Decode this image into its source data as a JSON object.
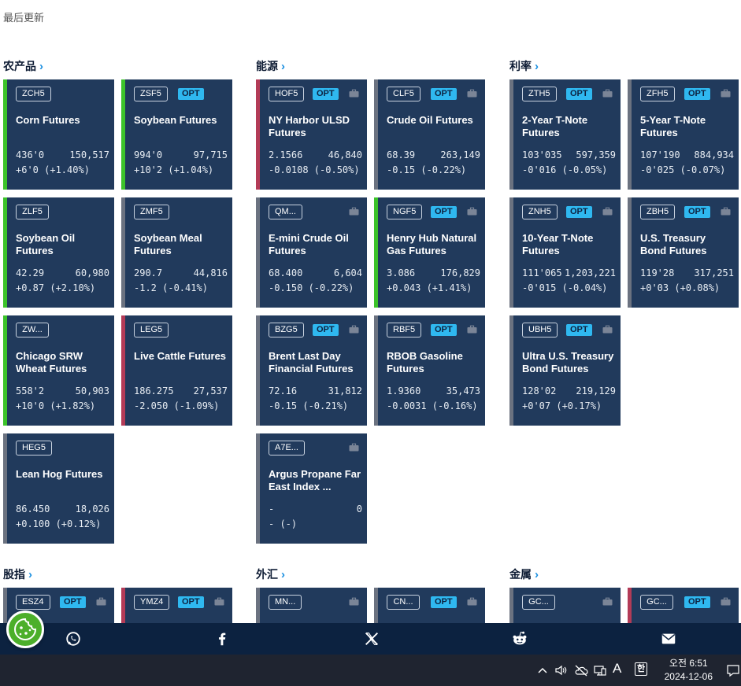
{
  "header": {
    "last_updated": "最后更新"
  },
  "sections": {
    "agri": "农产品",
    "energy": "能源",
    "rates": "利率",
    "equity": "股指",
    "fx": "外汇",
    "metals": "金属"
  },
  "opt_label": "OPT",
  "cards": [
    {
      "code": "ZCH5",
      "opt": false,
      "name": "Corn Futures",
      "price": "436'0",
      "volume": "150,517",
      "change": "+6'0 (+1.40%)",
      "trend": "up"
    },
    {
      "code": "ZSF5",
      "opt": true,
      "name": "Soybean Futures",
      "price": "994'0",
      "volume": "97,715",
      "change": "+10'2 (+1.04%)",
      "trend": "up"
    },
    {
      "code": "HOF5",
      "opt": true,
      "name": "NY Harbor ULSD Futures",
      "price": "2.1566",
      "volume": "46,840",
      "change": "-0.0108 (-0.50%)",
      "trend": "down"
    },
    {
      "code": "CLF5",
      "opt": true,
      "name": "Crude Oil Futures",
      "price": "68.39",
      "volume": "263,149",
      "change": "-0.15 (-0.22%)",
      "trend": "flat"
    },
    {
      "code": "ZTH5",
      "opt": true,
      "name": "2-Year T-Note Futures",
      "price": "103'035",
      "volume": "597,359",
      "change": "-0'016 (-0.05%)",
      "trend": "flat"
    },
    {
      "code": "ZFH5",
      "opt": true,
      "name": "5-Year T-Note Futures",
      "price": "107'190",
      "volume": "884,934",
      "change": "-0'025 (-0.07%)",
      "trend": "flat"
    },
    {
      "code": "ZLF5",
      "opt": false,
      "name": "Soybean Oil Futures",
      "price": "42.29",
      "volume": "60,980",
      "change": "+0.87 (+2.10%)",
      "trend": "up"
    },
    {
      "code": "ZMF5",
      "opt": false,
      "name": "Soybean Meal Futures",
      "price": "290.7",
      "volume": "44,816",
      "change": "-1.2 (-0.41%)",
      "trend": "flat"
    },
    {
      "code": "QM...",
      "opt": false,
      "name": "E-mini Crude Oil Futures",
      "price": "68.400",
      "volume": "6,604",
      "change": "-0.150 (-0.22%)",
      "trend": "flat"
    },
    {
      "code": "NGF5",
      "opt": true,
      "name": "Henry Hub Natural Gas Futures",
      "price": "3.086",
      "volume": "176,829",
      "change": "+0.043 (+1.41%)",
      "trend": "up"
    },
    {
      "code": "ZNH5",
      "opt": true,
      "name": "10-Year T-Note Futures",
      "price": "111'065",
      "volume": "1,203,221",
      "change": "-0'015 (-0.04%)",
      "trend": "flat"
    },
    {
      "code": "ZBH5",
      "opt": true,
      "name": "U.S. Treasury Bond Futures",
      "price": "119'28",
      "volume": "317,251",
      "change": "+0'03 (+0.08%)",
      "trend": "flat"
    },
    {
      "code": "ZW...",
      "opt": false,
      "name": "Chicago SRW Wheat Futures",
      "price": "558'2",
      "volume": "50,903",
      "change": "+10'0 (+1.82%)",
      "trend": "up"
    },
    {
      "code": "LEG5",
      "opt": false,
      "name": "Live Cattle Futures",
      "price": "186.275",
      "volume": "27,537",
      "change": "-2.050 (-1.09%)",
      "trend": "down"
    },
    {
      "code": "BZG5",
      "opt": true,
      "name": "Brent Last Day Financial Futures",
      "price": "72.16",
      "volume": "31,812",
      "change": "-0.15 (-0.21%)",
      "trend": "flat"
    },
    {
      "code": "RBF5",
      "opt": true,
      "name": "RBOB Gasoline Futures",
      "price": "1.9360",
      "volume": "35,473",
      "change": "-0.0031 (-0.16%)",
      "trend": "flat"
    },
    {
      "code": "UBH5",
      "opt": true,
      "name": "Ultra U.S. Treasury Bond Futures",
      "price": "128'02",
      "volume": "219,129",
      "change": "+0'07 (+0.17%)",
      "trend": "flat"
    },
    {
      "code": "HEG5",
      "opt": false,
      "name": "Lean Hog Futures",
      "price": "86.450",
      "volume": "18,026",
      "change": "+0.100 (+0.12%)",
      "trend": "flat"
    },
    {
      "code": "A7E...",
      "opt": false,
      "name": "Argus Propane Far East Index ...",
      "price": "-",
      "volume": "0",
      "change": "- (-)",
      "trend": "flat"
    },
    {
      "code": "ESZ4",
      "opt": true,
      "name": "",
      "price": "",
      "volume": "",
      "change": "",
      "trend": "flat"
    },
    {
      "code": "YMZ4",
      "opt": true,
      "name": "",
      "price": "",
      "volume": "",
      "change": "",
      "trend": "down"
    },
    {
      "code": "MN...",
      "opt": false,
      "name": "",
      "price": "",
      "volume": "",
      "change": "",
      "trend": "flat"
    },
    {
      "code": "CN...",
      "opt": true,
      "name": "",
      "price": "",
      "volume": "",
      "change": "",
      "trend": "flat"
    },
    {
      "code": "GC...",
      "opt": false,
      "name": "",
      "price": "",
      "volume": "",
      "change": "",
      "trend": "flat"
    },
    {
      "code": "GC...",
      "opt": true,
      "name": "",
      "price": "",
      "volume": "",
      "change": "",
      "trend": "down"
    }
  ],
  "taskbar": {
    "ime_letter": "A",
    "ime_korean": "한",
    "time": "오전 6:51",
    "date": "2024-12-06"
  },
  "colors": {
    "up": "#3cc32a",
    "down": "#b33b57",
    "flat": "#6b7280",
    "card_bg": "#213a5c",
    "opt_bg": "#2fb8f0"
  }
}
